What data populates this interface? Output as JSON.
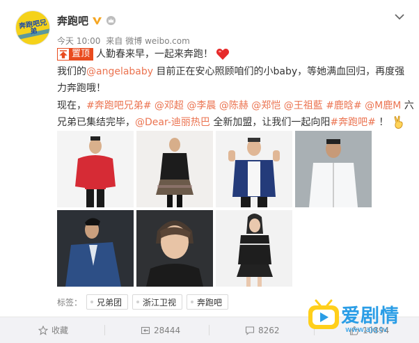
{
  "user": {
    "name": "奔跑吧",
    "avatar_text": "奔跑吧兄弟"
  },
  "icons": {
    "verified": "verified-v-icon",
    "member": "member-crown-icon",
    "more": "chevron-down-icon"
  },
  "meta": {
    "time": "今天 10:00",
    "from": "来自",
    "source": "微博 weibo.com"
  },
  "post": {
    "pin_label": "置顶",
    "line1": "人勤春来早，一起来奔跑！",
    "line2_pre": "我们的",
    "mention_angelababy": "@angelababy",
    "line2_post": " 目前正在安心照顾咱们的小baby，等她满血回归，再度强",
    "line3": "力奔跑哦！",
    "line4_pre": "现在，",
    "topic_brothers": "#奔跑吧兄弟#",
    "mentions_line4": [
      "@邓超",
      "@李晨",
      "@陈赫",
      "@郑恺",
      "@王祖藍",
      "#鹿晗#",
      "@M鹿M"
    ],
    "line4_post": " 六",
    "line5_pre": "兄弟已集结完毕，",
    "mention_dilireba": "@Dear-迪丽热巴",
    "line5_mid": " 全新加盟，让我们一起向阳",
    "topic_run": "#奔跑吧#",
    "line5_post": " ！"
  },
  "photos": [
    {
      "alt": "red jacket man",
      "bg": "#f4f4f4"
    },
    {
      "alt": "man in black skirt outfit",
      "bg": "#f1efed"
    },
    {
      "alt": "man in blue blazer",
      "bg": "#f3f3f3"
    },
    {
      "alt": "man in white shirt",
      "bg": "#a9b0b4"
    },
    {
      "alt": "man in navy suit",
      "bg": "#2c3036"
    },
    {
      "alt": "young man portrait",
      "bg": "#2f3134"
    },
    {
      "alt": "woman in black jacket",
      "bg": "#f2f2f2"
    }
  ],
  "tags": {
    "label": "标签：",
    "items": [
      "兄弟团",
      "浙江卫视",
      "奔跑吧"
    ]
  },
  "actions": {
    "favorite": "收藏",
    "repost": "28444",
    "comment": "8262",
    "like": "10894"
  },
  "watermark": {
    "title": "爱剧情",
    "url": "www.ajq.tv"
  },
  "colors": {
    "link": "#eb7350",
    "pin": "#e94b1e",
    "watermark": "#2a9de6"
  }
}
